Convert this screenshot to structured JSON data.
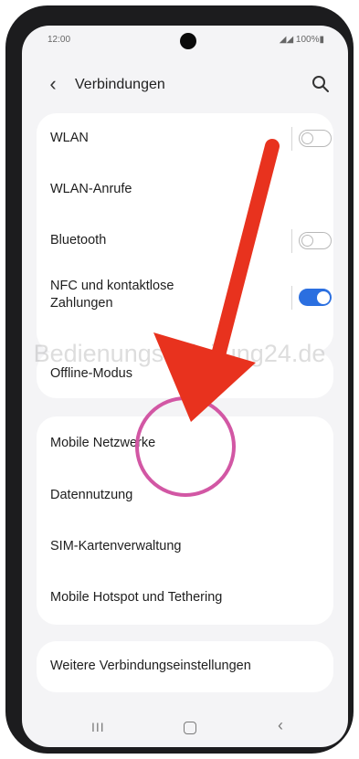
{
  "status": {
    "time": "12:00",
    "indicators": "◢◢ 100%▮"
  },
  "header": {
    "title": "Verbindungen"
  },
  "group1": [
    {
      "label": "WLAN",
      "toggle": "off"
    },
    {
      "label": "WLAN-Anrufe"
    },
    {
      "label": "Bluetooth",
      "toggle": "off"
    },
    {
      "label": "NFC und kontaktlose\nZahlungen",
      "toggle": "on"
    }
  ],
  "group2": [
    {
      "label": "Offline-Modus"
    }
  ],
  "group3": [
    {
      "label": "Mobile Netzwerke"
    },
    {
      "label": "Datennutzung"
    },
    {
      "label": "SIM-Kartenverwaltung"
    },
    {
      "label": "Mobile Hotspot und Tethering"
    }
  ],
  "group4": [
    {
      "label": "Weitere Verbindungseinstellungen"
    }
  ],
  "watermark": "Bedienungsanleitung24.de",
  "navbar": {
    "recent": "III",
    "back": "‹"
  },
  "colors": {
    "toggle_on": "#2b6fe0",
    "arrow": "#e8321e",
    "circle": "#d257a4"
  }
}
